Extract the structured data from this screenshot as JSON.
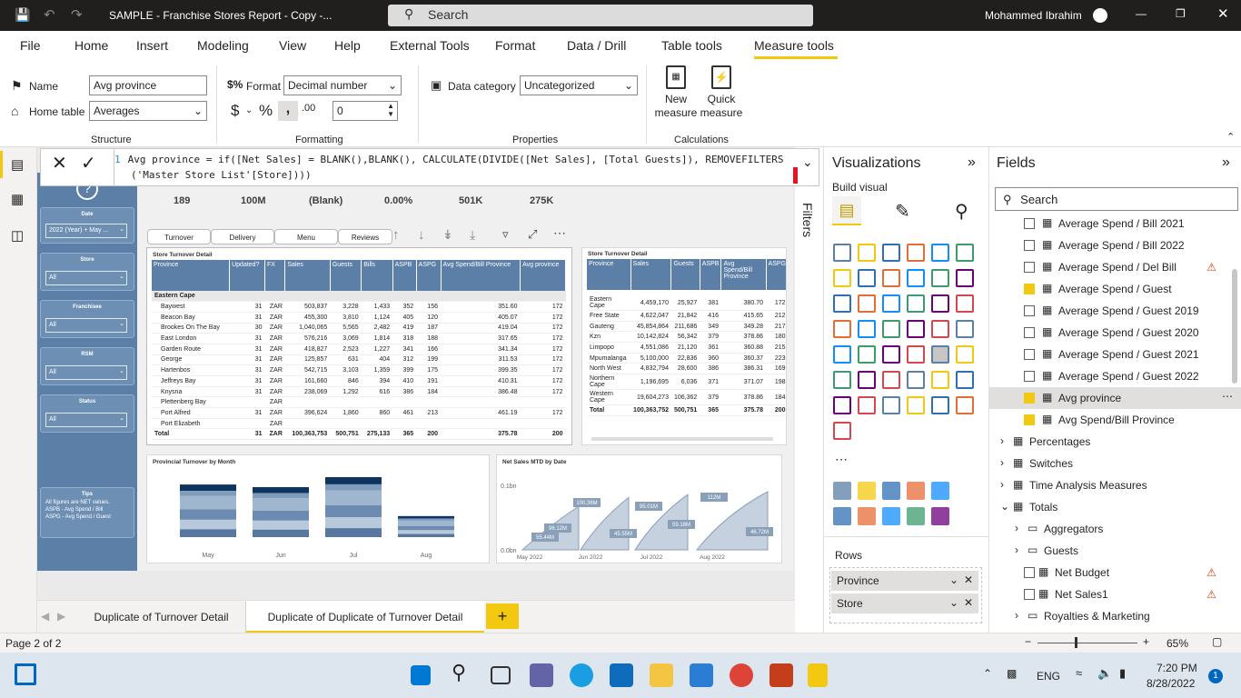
{
  "titlebar": {
    "title": "SAMPLE - Franchise Stores Report - Copy -...",
    "search": "Search",
    "user": "Mohammed Ibrahim"
  },
  "menu": [
    "File",
    "Home",
    "Insert",
    "Modeling",
    "View",
    "Help",
    "External Tools",
    "Format",
    "Data / Drill",
    "Table tools",
    "Measure tools"
  ],
  "ribbon": {
    "name_label": "Name",
    "name_value": "Avg province",
    "home_table_label": "Home table",
    "home_table_value": "Averages",
    "structure": "Structure",
    "format_label": "Format",
    "format_value": "Decimal number",
    "decimals_value": "0",
    "formatting": "Formatting",
    "data_category_label": "Data category",
    "data_category_value": "Uncategorized",
    "properties": "Properties",
    "new_measure": "New measure",
    "quick_measure": "Quick measure",
    "calculations": "Calculations"
  },
  "formula": {
    "line_no": "1",
    "line1": "Avg province = if([Net Sales] = BLANK(),BLANK(), CALCULATE(DIVIDE([Net Sales], [Total Guests]), REMOVEFILTERS",
    "line2": "('Master Store List'[Store])))"
  },
  "kpis": [
    {
      "value": "189"
    },
    {
      "value": "100M"
    },
    {
      "value": "(Blank)"
    },
    {
      "value": "0.00%"
    },
    {
      "value": "501K"
    },
    {
      "value": "275K"
    }
  ],
  "report_tabs": [
    "Turnover",
    "Delivery",
    "Menu",
    "Reviews"
  ],
  "slicers": [
    {
      "label": "Date",
      "value": "2022 (Year) + May ..."
    },
    {
      "label": "Store",
      "value": "All"
    },
    {
      "label": "Franchisee",
      "value": "All"
    },
    {
      "label": "RSM",
      "value": "All"
    },
    {
      "label": "Status",
      "value": "All"
    }
  ],
  "tips": {
    "title": "Tips",
    "lines": [
      "All figures are NET values.",
      "ASPB - Avg Spend / Bill",
      "ASPG - Avg Spend / Guest"
    ]
  },
  "store_table": {
    "title": "Store Turnover Detail",
    "headers": [
      "Province",
      "Updated?",
      "FX",
      "Sales",
      "Guests",
      "Bills",
      "ASPB",
      "ASPG",
      "Avg Spend/Bill Province",
      "Avg province"
    ],
    "group": "Eastern Cape",
    "rows": [
      [
        "Baywest",
        "31",
        "ZAR",
        "503,837",
        "3,228",
        "1,433",
        "352",
        "156",
        "351.60",
        "172"
      ],
      [
        "Beacon Bay",
        "31",
        "ZAR",
        "455,300",
        "3,810",
        "1,124",
        "405",
        "120",
        "405.07",
        "172"
      ],
      [
        "Brookes On The Bay",
        "30",
        "ZAR",
        "1,040,065",
        "5,565",
        "2,482",
        "419",
        "187",
        "419.04",
        "172"
      ],
      [
        "East London",
        "31",
        "ZAR",
        "576,216",
        "3,069",
        "1,814",
        "318",
        "188",
        "317.65",
        "172"
      ],
      [
        "Garden Route",
        "31",
        "ZAR",
        "418,827",
        "2,523",
        "1,227",
        "341",
        "166",
        "341.34",
        "172"
      ],
      [
        "George",
        "31",
        "ZAR",
        "125,857",
        "631",
        "404",
        "312",
        "199",
        "311.53",
        "172"
      ],
      [
        "Hartenbos",
        "31",
        "ZAR",
        "542,715",
        "3,103",
        "1,359",
        "399",
        "175",
        "399.35",
        "172"
      ],
      [
        "Jeffreys Bay",
        "31",
        "ZAR",
        "161,660",
        "846",
        "394",
        "410",
        "191",
        "410.31",
        "172"
      ],
      [
        "Knysna",
        "31",
        "ZAR",
        "238,069",
        "1,292",
        "616",
        "386",
        "184",
        "386.48",
        "172"
      ],
      [
        "Plettenberg Bay",
        "",
        "ZAR",
        "",
        "",
        "",
        "",
        "",
        "",
        ""
      ],
      [
        "Port Alfred",
        "31",
        "ZAR",
        "396,624",
        "1,860",
        "860",
        "461",
        "213",
        "461.19",
        "172"
      ],
      [
        "Port Elizabeth",
        "",
        "ZAR",
        "",
        "",
        "",
        "",
        "",
        "",
        ""
      ]
    ],
    "total": [
      "Total",
      "31",
      "ZAR",
      "100,363,753",
      "500,751",
      "275,133",
      "365",
      "200",
      "375.78",
      "200"
    ]
  },
  "prov_table": {
    "title": "Store Turnover Detail",
    "headers": [
      "Province",
      "Sales",
      "Guests",
      "ASPB",
      "Avg Spend/Bill Province",
      "ASPG"
    ],
    "rows": [
      [
        "Eastern Cape",
        "4,459,170",
        "25,927",
        "381",
        "380.70",
        "172"
      ],
      [
        "Free State",
        "4,622,047",
        "21,842",
        "416",
        "415.65",
        "212"
      ],
      [
        "Gauteng",
        "45,854,864",
        "211,686",
        "349",
        "349.28",
        "217"
      ],
      [
        "Kzn",
        "10,142,824",
        "56,342",
        "379",
        "378.86",
        "180"
      ],
      [
        "Limpopo",
        "4,551,086",
        "21,120",
        "361",
        "360.88",
        "215"
      ],
      [
        "Mpumalanga",
        "5,100,000",
        "22,836",
        "360",
        "360.37",
        "223"
      ],
      [
        "North West",
        "4,832,794",
        "28,600",
        "386",
        "386.31",
        "169"
      ],
      [
        "Northern Cape",
        "1,196,695",
        "6,036",
        "371",
        "371.07",
        "198"
      ],
      [
        "Western Cape",
        "19,604,273",
        "106,362",
        "379",
        "378.86",
        "184"
      ]
    ],
    "total": [
      "Total",
      "100,363,752",
      "500,751",
      "365",
      "375.78",
      "200"
    ]
  },
  "chart_data": [
    {
      "type": "bar",
      "title": "Provincial Turnover by Month",
      "categories": [
        "May",
        "Jun",
        "Jul",
        "Aug"
      ],
      "values": [
        1,
        0.95,
        1.14,
        0.4
      ]
    },
    {
      "type": "area",
      "title": "Net Sales MTD by Date",
      "y_ticks": [
        "0.1bn",
        "0.0bn"
      ],
      "x_ticks": [
        "May 2022",
        "Jun 2022",
        "Jul 2022",
        "Aug 2022"
      ],
      "labels": [
        "55.44M",
        "96.12M",
        "100.36M",
        "45.55M",
        "95.01M",
        "59.18M",
        "112M",
        "46.72M"
      ]
    }
  ],
  "visualizations": {
    "title": "Visualizations",
    "build": "Build visual",
    "rows_label": "Rows",
    "rows": [
      "Province",
      "Store"
    ]
  },
  "filters_label": "Filters",
  "fields": {
    "title": "Fields",
    "search": "Search",
    "items": [
      {
        "label": "Average Spend / Bill 2021",
        "checked": false,
        "warn": false,
        "indent": 1
      },
      {
        "label": "Average Spend / Bill 2022",
        "checked": false,
        "warn": false,
        "indent": 1
      },
      {
        "label": "Average Spend / Del Bill",
        "checked": false,
        "warn": true,
        "indent": 1
      },
      {
        "label": "Average Spend / Guest",
        "checked": true,
        "warn": false,
        "indent": 1
      },
      {
        "label": "Average Spend / Guest 2019",
        "checked": false,
        "warn": false,
        "indent": 1
      },
      {
        "label": "Average Spend / Guest 2020",
        "checked": false,
        "warn": false,
        "indent": 1
      },
      {
        "label": "Average Spend / Guest 2021",
        "checked": false,
        "warn": false,
        "indent": 1
      },
      {
        "label": "Average Spend / Guest 2022",
        "checked": false,
        "warn": false,
        "indent": 1
      },
      {
        "label": "Avg province",
        "checked": true,
        "warn": false,
        "indent": 1,
        "selected": true
      },
      {
        "label": "Avg Spend/Bill Province",
        "checked": true,
        "warn": false,
        "indent": 1
      }
    ],
    "groups": [
      {
        "label": "Percentages"
      },
      {
        "label": "Switches"
      },
      {
        "label": "Time Analysis Measures"
      },
      {
        "label": "Totals"
      },
      {
        "label": "Aggregators"
      },
      {
        "label": "Guests"
      },
      {
        "label": "Net Budget"
      },
      {
        "label": "Net Sales1"
      },
      {
        "label": "Royalties & Marketing"
      }
    ]
  },
  "page_tabs": [
    "Duplicate of Turnover Detail",
    "Duplicate of Duplicate of Turnover Detail"
  ],
  "status": {
    "page": "Page 2 of 2",
    "zoom": "65%"
  },
  "taskbar": {
    "lang": "ENG",
    "time": "7:20 PM",
    "date": "8/28/2022",
    "badge": "1"
  }
}
